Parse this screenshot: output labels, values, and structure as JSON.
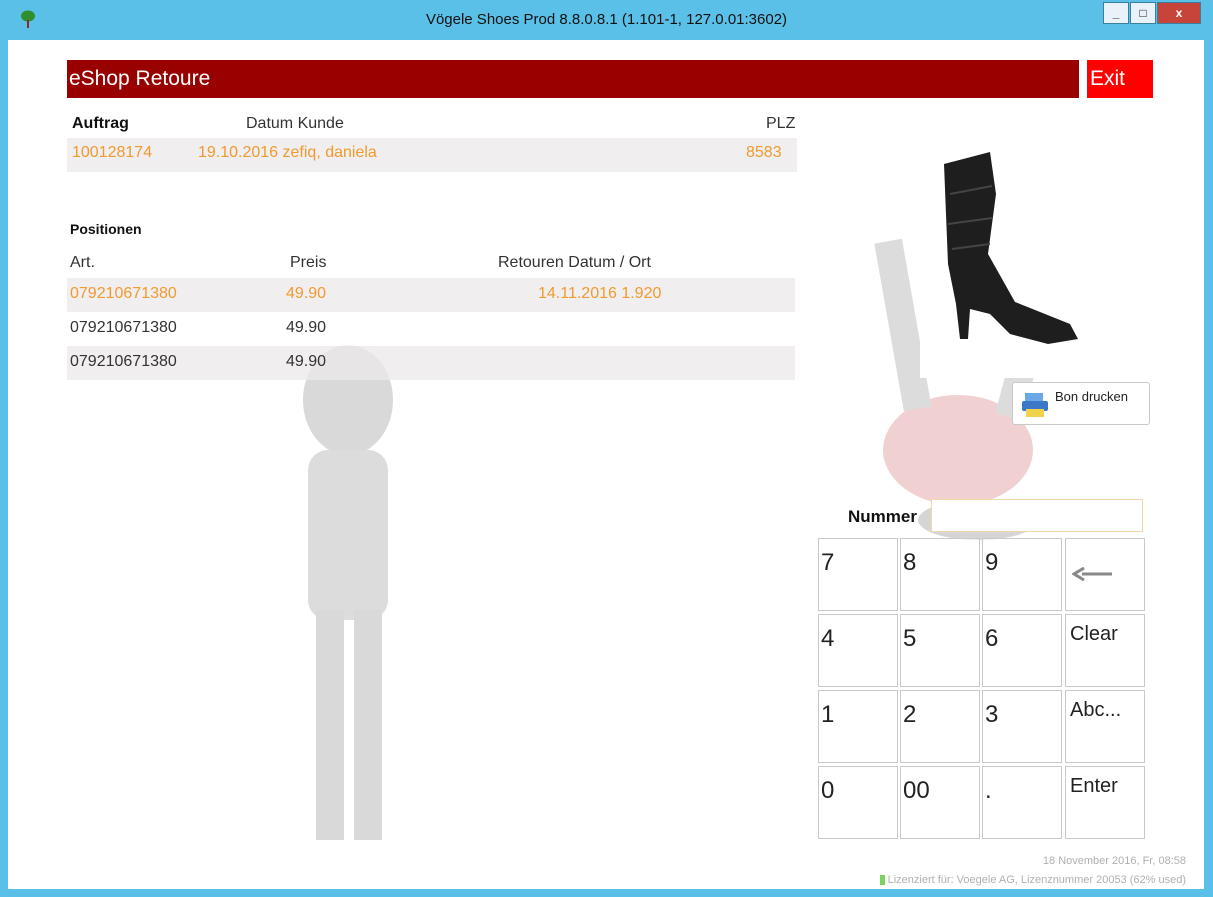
{
  "window": {
    "title": "Vögele Shoes Prod 8.8.0.8.1 (1.101-1, 127.0.01:3602)",
    "minimize": "_",
    "maximize": "□",
    "close": "x"
  },
  "header": {
    "title": "eShop Retoure",
    "exit_label": "Exit"
  },
  "order": {
    "col_auftrag": "Auftrag",
    "col_datum_kunde": "Datum Kunde",
    "col_plz": "PLZ",
    "auftrag": "100128174",
    "datum_kunde": "19.10.2016 zefiq, daniela",
    "plz": "8583"
  },
  "positions": {
    "section_label": "Positionen",
    "col_art": "Art.",
    "col_preis": "Preis",
    "col_retouren": "Retouren Datum / Ort",
    "rows": [
      {
        "art": "079210671380",
        "preis": "49.90",
        "retouren": "14.11.2016 1.920"
      },
      {
        "art": "079210671380",
        "preis": "49.90",
        "retouren": ""
      },
      {
        "art": "079210671380",
        "preis": "49.90",
        "retouren": ""
      }
    ]
  },
  "bon_button": {
    "label": "Bon drucken",
    "icon": "printer-icon"
  },
  "nummer": {
    "label": "Nummer",
    "value": ""
  },
  "keypad": {
    "keys": [
      "7",
      "8",
      "9",
      "←",
      "4",
      "5",
      "6",
      "Clear",
      "1",
      "2",
      "3",
      "Abc...",
      "0",
      "00",
      ".",
      "Enter"
    ]
  },
  "footer": {
    "datetime": "18 November 2016, Fr, 08:58",
    "license": "Lizenziert für: Voegele AG, Lizenznummer 20053 (62% used)"
  },
  "colors": {
    "header": "#990000",
    "exit": "#ff0000",
    "accent_text": "#f09a30",
    "titlebar": "#5bc0e8"
  }
}
